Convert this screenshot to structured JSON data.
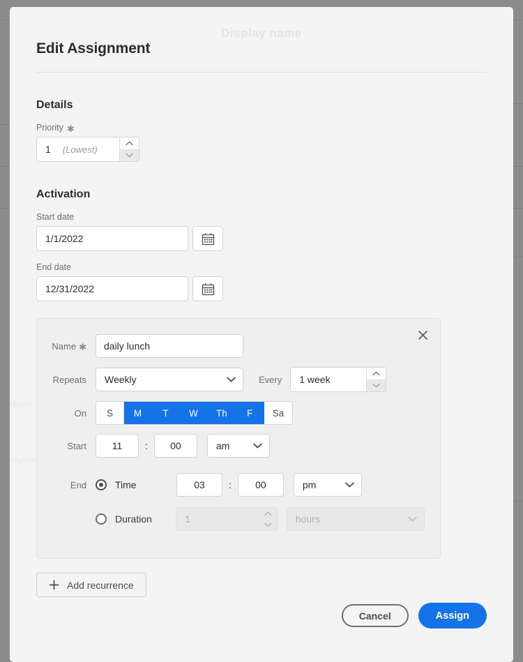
{
  "modal": {
    "title": "Edit Assignment",
    "ghost_behind": "Display name",
    "ghost_left_1": "Name",
    "ghost_left_2": "Signature"
  },
  "details": {
    "section_title": "Details",
    "priority_label": "Priority",
    "required_mark": "✱",
    "priority_value": "1",
    "priority_hint": "(Lowest)"
  },
  "activation": {
    "section_title": "Activation",
    "start_date_label": "Start date",
    "start_date_value": "1/1/2022",
    "end_date_label": "End date",
    "end_date_value": "12/31/2022"
  },
  "recurrence": {
    "name_label": "Name",
    "name_value": "daily lunch",
    "repeats_label": "Repeats",
    "repeats_value": "Weekly",
    "every_label": "Every",
    "every_value": "1 week",
    "on_label": "On",
    "days": [
      {
        "label": "S",
        "selected": false
      },
      {
        "label": "M",
        "selected": true
      },
      {
        "label": "T",
        "selected": true
      },
      {
        "label": "W",
        "selected": true
      },
      {
        "label": "Th",
        "selected": true
      },
      {
        "label": "F",
        "selected": true
      },
      {
        "label": "Sa",
        "selected": false
      }
    ],
    "start_label": "Start",
    "start_hour": "11",
    "start_colon": ":",
    "start_minute": "00",
    "start_meridiem": "am",
    "end_label": "End",
    "end_mode": "time",
    "end_time_option": "Time",
    "end_hour": "03",
    "end_colon": ":",
    "end_minute": "00",
    "end_meridiem": "pm",
    "duration_option": "Duration",
    "duration_value": "1",
    "duration_unit": "hours"
  },
  "actions": {
    "add_recurrence": "Add recurrence",
    "add_icon": "plus-icon",
    "cancel": "Cancel",
    "assign": "Assign"
  },
  "colors": {
    "accent_blue": "#1473e6",
    "overlay_gray": "#8c8c8c",
    "modal_bg": "#f4f4f4",
    "card_bg": "#efefef"
  }
}
